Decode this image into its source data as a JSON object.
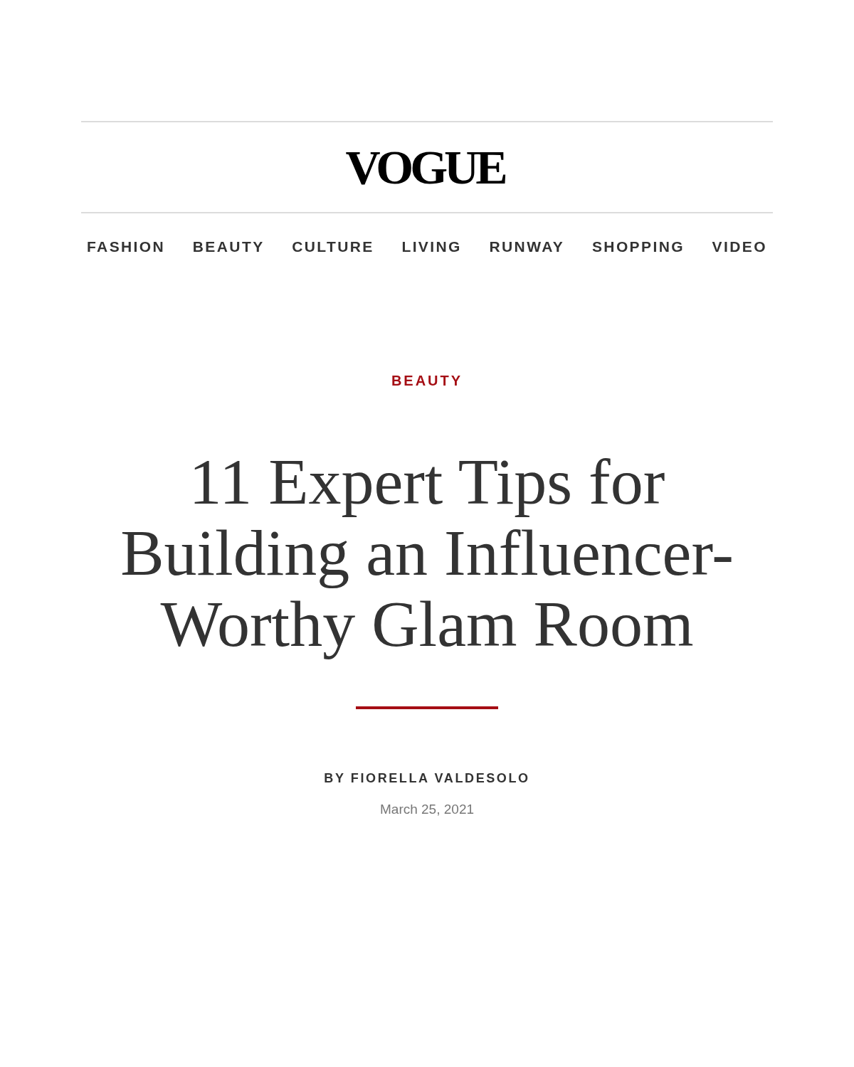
{
  "header": {
    "logo": "VOGUE",
    "nav": [
      {
        "label": "FASHION"
      },
      {
        "label": "BEAUTY"
      },
      {
        "label": "CULTURE"
      },
      {
        "label": "LIVING"
      },
      {
        "label": "RUNWAY"
      },
      {
        "label": "SHOPPING"
      },
      {
        "label": "VIDEO"
      }
    ]
  },
  "article": {
    "rubric": "BEAUTY",
    "title": "11 Expert Tips for Building an Influencer-Worthy Glam Room",
    "byline": "BY FIORELLA VALDESOLO",
    "date": "March 25, 2021"
  }
}
